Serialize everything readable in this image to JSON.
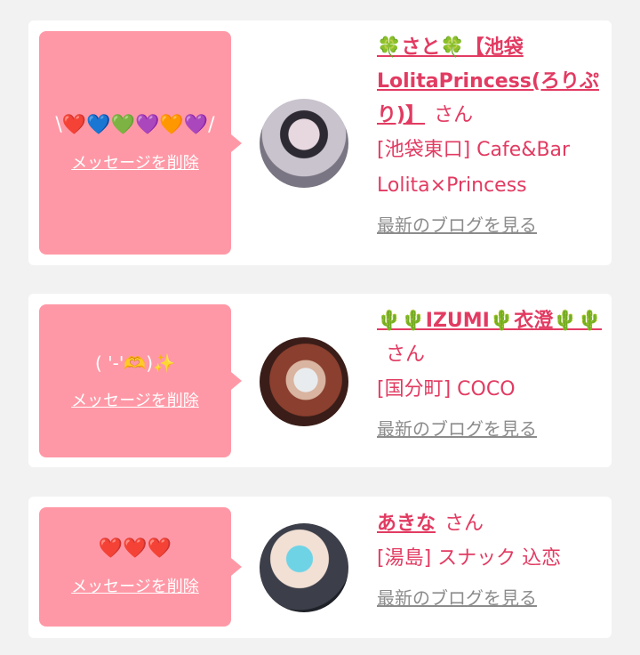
{
  "cards": [
    {
      "message": "\\❤️💙💚💜🧡💜/",
      "delete_label": "メッセージを削除",
      "name": "🍀さと🍀【池袋LolitaPrincess(ろりぷり)】",
      "honorific": "さん",
      "shop": "[池袋東口] Cafe&Bar Lolita×Princess",
      "blog_label": "最新のブログを見る"
    },
    {
      "message": "( '-'🫶)✨",
      "delete_label": "メッセージを削除",
      "name": "🌵🌵IZUMI🌵衣澄🌵🌵",
      "honorific": "さん",
      "shop": "[国分町] COCO",
      "blog_label": "最新のブログを見る"
    },
    {
      "message": "❤️❤️❤️",
      "delete_label": "メッセージを削除",
      "name": "あきな",
      "honorific": "さん",
      "shop": "[湯島] スナック 込恋",
      "blog_label": "最新のブログを見る"
    }
  ]
}
